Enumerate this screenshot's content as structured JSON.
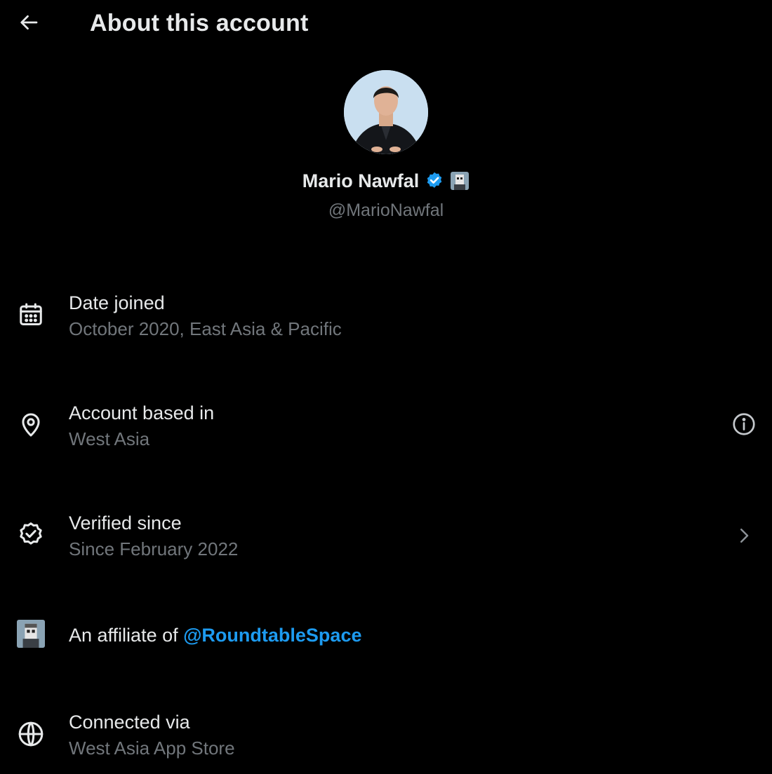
{
  "header": {
    "title": "About this account",
    "back_icon": "arrow-left-icon"
  },
  "profile": {
    "name": "Mario Nawfal",
    "handle": "@MarioNawfal",
    "verified_color": "#1d9bf0"
  },
  "rows": [
    {
      "icon": "calendar-icon",
      "label": "Date joined",
      "value": "October 2020, East Asia & Pacific"
    },
    {
      "icon": "location-pin-icon",
      "label": "Account based in",
      "value": "West Asia",
      "right_icon": "info-icon"
    },
    {
      "icon": "verified-badge-icon",
      "label": "Verified since",
      "value": "Since February 2022",
      "right_icon": "chevron-right-icon"
    },
    {
      "icon": "affiliate-avatar-icon",
      "label_prefix": "An affiliate of ",
      "link": "@RoundtableSpace"
    },
    {
      "icon": "globe-icon",
      "label": "Connected via",
      "value": "West Asia App Store"
    }
  ],
  "colors": {
    "background": "#000000",
    "text": "#e7e9ea",
    "muted": "#71767b",
    "accent": "#1d9bf0"
  }
}
